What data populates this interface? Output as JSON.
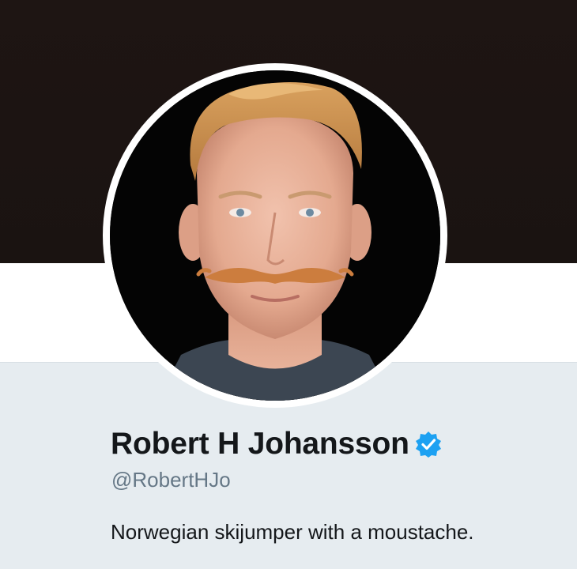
{
  "profile": {
    "display_name": "Robert H Johansson",
    "handle": "@RobertHJo",
    "bio": "Norwegian skijumper with a moustache.",
    "verified": true
  },
  "icons": {
    "verified": "verified-badge-icon"
  },
  "colors": {
    "banner": "#1e1513",
    "info_background": "#e6ecf0",
    "verified_blue": "#1da1f2",
    "name_text": "#14171a",
    "handle_text": "#657786"
  }
}
